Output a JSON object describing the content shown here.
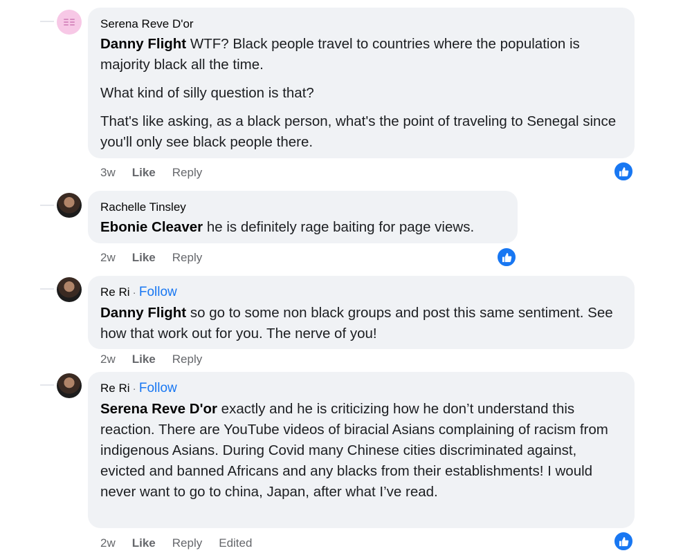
{
  "comments": [
    {
      "author": "Serena Reve D'or",
      "follow": "",
      "mention": "Danny Flight",
      "paragraphs": [
        "WTF? Black people travel to countries where the population is majority black all the time.",
        "What kind of silly question is that?",
        "That's like asking, as a black person, what's the point of traveling to Senegal since you'll only see black people there."
      ],
      "time": "3w",
      "like_label": "Like",
      "reply_label": "Reply",
      "edited_label": "",
      "reaction_icon": "thumbs-up-icon"
    },
    {
      "author": "Rachelle Tinsley",
      "follow": "",
      "mention": "Ebonie Cleaver",
      "paragraphs": [
        "he is definitely rage baiting for page views."
      ],
      "time": "2w",
      "like_label": "Like",
      "reply_label": "Reply",
      "edited_label": "",
      "reaction_icon": "thumbs-up-icon"
    },
    {
      "author": "Re Ri",
      "separator": "·",
      "follow": "Follow",
      "mention": "Danny Flight",
      "paragraphs": [
        "so go to some non black groups and post this same sentiment. See how that work out for you. The nerve of you!"
      ],
      "time": "2w",
      "like_label": "Like",
      "reply_label": "Reply",
      "edited_label": ""
    },
    {
      "author": "Re Ri",
      "separator": "·",
      "follow": "Follow",
      "mention": "Serena Reve D'or",
      "paragraphs": [
        "exactly and he is criticizing how he don’t understand this reaction. There are YouTube videos of biracial Asians complaining of racism from indigenous Asians. During Covid many Chinese cities discriminated against, evicted and banned Africans and any blacks from their establishments! I would never want to go to china, Japan, after what I’ve read."
      ],
      "time": "2w",
      "like_label": "Like",
      "reply_label": "Reply",
      "edited_label": "Edited",
      "reaction_icon": "thumbs-up-icon"
    }
  ],
  "colors": {
    "bubble": "#f0f2f5",
    "link": "#1877f2",
    "meta": "#65676b",
    "reaction": "#1877f2"
  }
}
